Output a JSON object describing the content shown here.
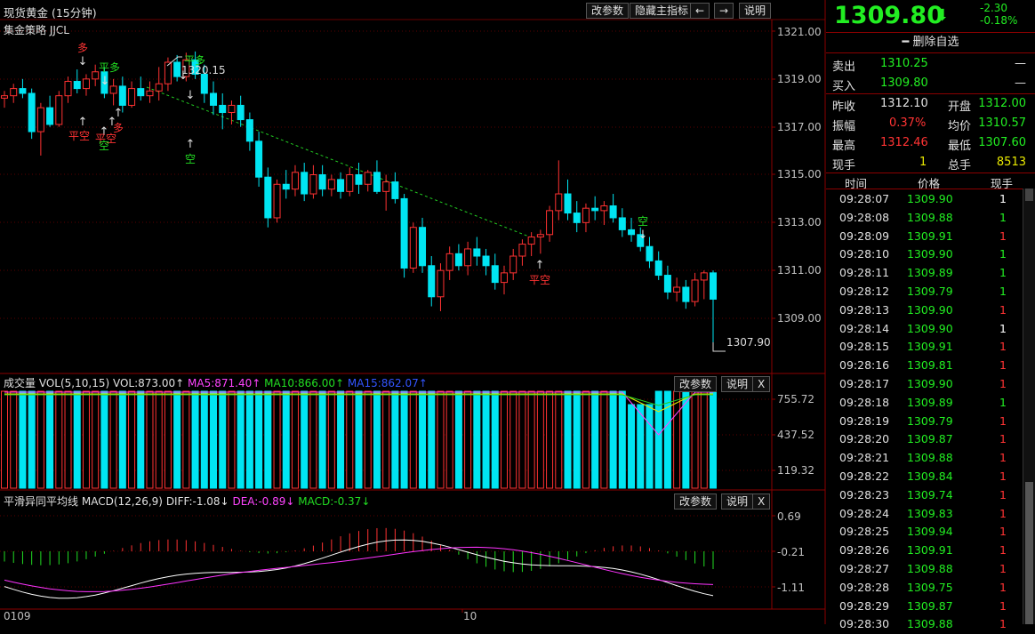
{
  "window": {
    "title": "现货黄金 (15分钟)",
    "buttons": [
      "改参数",
      "隐藏主指标",
      "←",
      "→",
      "说明"
    ]
  },
  "main_chart": {
    "strategy_label": "集金策略  JJCL",
    "y_ticks": [
      "1321.00",
      "1319.00",
      "1317.00",
      "1315.00",
      "1313.00",
      "1311.00",
      "1309.00"
    ],
    "high_label": "1320.15",
    "low_label": "1307.90",
    "signals": {
      "long": "多",
      "flat_long": "平多",
      "flat_short": "平空",
      "short": "空"
    }
  },
  "volume_panel": {
    "label_name": "成交量",
    "label_params": "VOL(5,10,15)",
    "vol": "VOL:873.00↑",
    "ma5": "MA5:871.40↑",
    "ma10": "MA10:866.00↑",
    "ma15": "MA15:862.07↑",
    "buttons": [
      "改参数",
      "说明",
      "X"
    ],
    "y_ticks": [
      "755.72",
      "437.52",
      "119.32"
    ]
  },
  "macd_panel": {
    "label_name": "平滑异同平均线",
    "label_params": "MACD(12,26,9)",
    "diff": "DIFF:-1.08↓",
    "dea": "DEA:-0.89↓",
    "macd": "MACD:-0.37↓",
    "buttons": [
      "改参数",
      "说明",
      "X"
    ],
    "y_ticks": [
      "0.69",
      "-0.21",
      "-1.11"
    ]
  },
  "x_axis": {
    "labels": [
      "0109",
      "10"
    ]
  },
  "quote": {
    "price": "1309.80",
    "arrow": "⬇",
    "change": "-2.30",
    "change_pct": "-0.18%",
    "delete_watch": "━ 删除自选",
    "sell_label": "卖出",
    "sell_value": "1310.25",
    "sell_qty": "—",
    "buy_label": "买入",
    "buy_value": "1309.80",
    "buy_qty": "—",
    "prev_close_label": "昨收",
    "prev_close": "1312.10",
    "open_label": "开盘",
    "open": "1312.00",
    "amplitude_label": "振幅",
    "amplitude": "0.37%",
    "avg_label": "均价",
    "avg": "1310.57",
    "high_label": "最高",
    "high": "1312.46",
    "low_label": "最低",
    "low": "1307.60",
    "cur_vol_label": "现手",
    "cur_vol": "1",
    "total_vol_label": "总手",
    "total_vol": "8513"
  },
  "trades": {
    "headers": [
      "时间",
      "价格",
      "现手"
    ],
    "rows": [
      [
        "09:28:07",
        "1309.90",
        "1"
      ],
      [
        "09:28:08",
        "1309.88",
        "1"
      ],
      [
        "09:28:09",
        "1309.91",
        "1"
      ],
      [
        "09:28:10",
        "1309.90",
        "1"
      ],
      [
        "09:28:11",
        "1309.89",
        "1"
      ],
      [
        "09:28:12",
        "1309.79",
        "1"
      ],
      [
        "09:28:13",
        "1309.90",
        "1"
      ],
      [
        "09:28:14",
        "1309.90",
        "1"
      ],
      [
        "09:28:15",
        "1309.91",
        "1"
      ],
      [
        "09:28:16",
        "1309.81",
        "1"
      ],
      [
        "09:28:17",
        "1309.90",
        "1"
      ],
      [
        "09:28:18",
        "1309.89",
        "1"
      ],
      [
        "09:28:19",
        "1309.79",
        "1"
      ],
      [
        "09:28:20",
        "1309.87",
        "1"
      ],
      [
        "09:28:21",
        "1309.88",
        "1"
      ],
      [
        "09:28:22",
        "1309.84",
        "1"
      ],
      [
        "09:28:23",
        "1309.74",
        "1"
      ],
      [
        "09:28:24",
        "1309.83",
        "1"
      ],
      [
        "09:28:25",
        "1309.94",
        "1"
      ],
      [
        "09:28:26",
        "1309.91",
        "1"
      ],
      [
        "09:28:27",
        "1309.88",
        "1"
      ],
      [
        "09:28:28",
        "1309.75",
        "1"
      ],
      [
        "09:28:29",
        "1309.87",
        "1"
      ],
      [
        "09:28:30",
        "1309.88",
        "1"
      ]
    ],
    "qty_colors": [
      "white",
      "green",
      "red",
      "green",
      "green",
      "green",
      "red",
      "white",
      "red",
      "red",
      "red",
      "green",
      "red",
      "red",
      "red",
      "red",
      "red",
      "red",
      "red",
      "red",
      "red",
      "red",
      "red",
      "red"
    ]
  },
  "chart_data": {
    "type": "candlestick",
    "title": "现货黄金 (15分钟)",
    "ylim": [
      1307.5,
      1321.3
    ],
    "candles": [
      [
        1318.2,
        1318.5,
        1317.8,
        1318.3
      ],
      [
        1318.3,
        1318.8,
        1318.0,
        1318.6
      ],
      [
        1318.6,
        1319.0,
        1318.2,
        1318.4
      ],
      [
        1318.4,
        1318.6,
        1316.5,
        1316.8
      ],
      [
        1316.8,
        1318.0,
        1315.8,
        1317.8
      ],
      [
        1317.8,
        1318.3,
        1317.0,
        1317.1
      ],
      [
        1317.1,
        1318.5,
        1317.0,
        1318.3
      ],
      [
        1318.3,
        1319.1,
        1318.0,
        1318.9
      ],
      [
        1318.9,
        1319.4,
        1318.4,
        1318.6
      ],
      [
        1318.6,
        1319.2,
        1318.3,
        1319.0
      ],
      [
        1319.0,
        1319.6,
        1318.7,
        1319.3
      ],
      [
        1319.3,
        1319.5,
        1318.2,
        1318.4
      ],
      [
        1318.4,
        1319.0,
        1317.9,
        1318.7
      ],
      [
        1318.7,
        1319.1,
        1317.6,
        1317.9
      ],
      [
        1317.9,
        1318.9,
        1317.8,
        1318.6
      ],
      [
        1318.6,
        1319.1,
        1318.1,
        1318.3
      ],
      [
        1318.3,
        1318.9,
        1318.0,
        1318.5
      ],
      [
        1318.5,
        1319.5,
        1318.1,
        1318.8
      ],
      [
        1318.8,
        1319.9,
        1318.5,
        1319.7
      ],
      [
        1319.7,
        1320.0,
        1318.9,
        1319.1
      ],
      [
        1319.1,
        1320.1,
        1318.9,
        1319.8
      ],
      [
        1319.8,
        1320.15,
        1319.0,
        1319.2
      ],
      [
        1319.2,
        1319.6,
        1318.0,
        1318.4
      ],
      [
        1318.4,
        1318.9,
        1317.5,
        1317.9
      ],
      [
        1317.9,
        1318.4,
        1316.9,
        1317.6
      ],
      [
        1317.6,
        1318.1,
        1317.1,
        1317.9
      ],
      [
        1317.9,
        1318.3,
        1317.0,
        1317.3
      ],
      [
        1317.3,
        1317.6,
        1316.0,
        1316.4
      ],
      [
        1316.4,
        1316.8,
        1314.5,
        1314.9
      ],
      [
        1314.9,
        1315.3,
        1312.8,
        1313.2
      ],
      [
        1313.2,
        1314.8,
        1313.0,
        1314.6
      ],
      [
        1314.6,
        1315.2,
        1314.0,
        1314.4
      ],
      [
        1314.4,
        1315.4,
        1314.1,
        1315.1
      ],
      [
        1315.1,
        1315.5,
        1313.9,
        1314.2
      ],
      [
        1314.2,
        1315.4,
        1314.0,
        1315.0
      ],
      [
        1315.0,
        1315.4,
        1314.1,
        1314.4
      ],
      [
        1314.4,
        1315.0,
        1314.1,
        1314.8
      ],
      [
        1314.8,
        1315.1,
        1314.0,
        1314.3
      ],
      [
        1314.3,
        1315.3,
        1314.1,
        1315.0
      ],
      [
        1315.0,
        1315.5,
        1314.2,
        1314.6
      ],
      [
        1314.6,
        1315.2,
        1314.3,
        1315.1
      ],
      [
        1315.1,
        1315.6,
        1314.2,
        1314.3
      ],
      [
        1314.3,
        1315.0,
        1313.5,
        1314.7
      ],
      [
        1314.7,
        1315.1,
        1313.8,
        1314.0
      ],
      [
        1314.0,
        1314.2,
        1310.7,
        1311.1
      ],
      [
        1311.1,
        1313.0,
        1310.9,
        1312.8
      ],
      [
        1312.8,
        1313.2,
        1310.9,
        1311.2
      ],
      [
        1311.2,
        1311.6,
        1309.5,
        1309.9
      ],
      [
        1309.9,
        1311.3,
        1309.3,
        1311.0
      ],
      [
        1311.0,
        1312.0,
        1310.6,
        1311.7
      ],
      [
        1311.7,
        1312.1,
        1311.0,
        1311.2
      ],
      [
        1311.2,
        1312.2,
        1310.8,
        1311.9
      ],
      [
        1311.9,
        1312.4,
        1311.2,
        1311.6
      ],
      [
        1311.6,
        1311.9,
        1310.8,
        1311.2
      ],
      [
        1311.2,
        1311.7,
        1310.2,
        1310.5
      ],
      [
        1310.5,
        1311.2,
        1310.0,
        1310.9
      ],
      [
        1310.9,
        1311.9,
        1310.6,
        1311.6
      ],
      [
        1311.6,
        1312.3,
        1311.2,
        1312.1
      ],
      [
        1312.1,
        1312.6,
        1311.6,
        1312.4
      ],
      [
        1312.4,
        1312.7,
        1311.7,
        1312.5
      ],
      [
        1312.5,
        1313.7,
        1312.2,
        1313.5
      ],
      [
        1313.5,
        1315.6,
        1313.1,
        1314.2
      ],
      [
        1314.2,
        1314.8,
        1313.1,
        1313.4
      ],
      [
        1313.4,
        1313.9,
        1312.6,
        1313.0
      ],
      [
        1313.0,
        1313.8,
        1312.6,
        1313.6
      ],
      [
        1313.6,
        1314.1,
        1313.1,
        1313.5
      ],
      [
        1313.5,
        1313.9,
        1312.9,
        1313.7
      ],
      [
        1313.7,
        1314.2,
        1313.0,
        1313.2
      ],
      [
        1313.2,
        1313.6,
        1312.4,
        1312.7
      ],
      [
        1312.7,
        1313.2,
        1312.2,
        1312.5
      ],
      [
        1312.5,
        1312.8,
        1311.8,
        1312.0
      ],
      [
        1312.0,
        1312.4,
        1311.1,
        1311.4
      ],
      [
        1311.4,
        1311.8,
        1310.6,
        1310.8
      ],
      [
        1310.8,
        1311.2,
        1309.8,
        1310.1
      ],
      [
        1310.1,
        1310.7,
        1309.7,
        1310.3
      ],
      [
        1310.3,
        1310.6,
        1309.4,
        1309.7
      ],
      [
        1309.7,
        1310.9,
        1309.5,
        1310.6
      ],
      [
        1310.6,
        1311.0,
        1309.8,
        1310.9
      ],
      [
        1310.9,
        1311.0,
        1307.9,
        1309.8
      ]
    ]
  }
}
